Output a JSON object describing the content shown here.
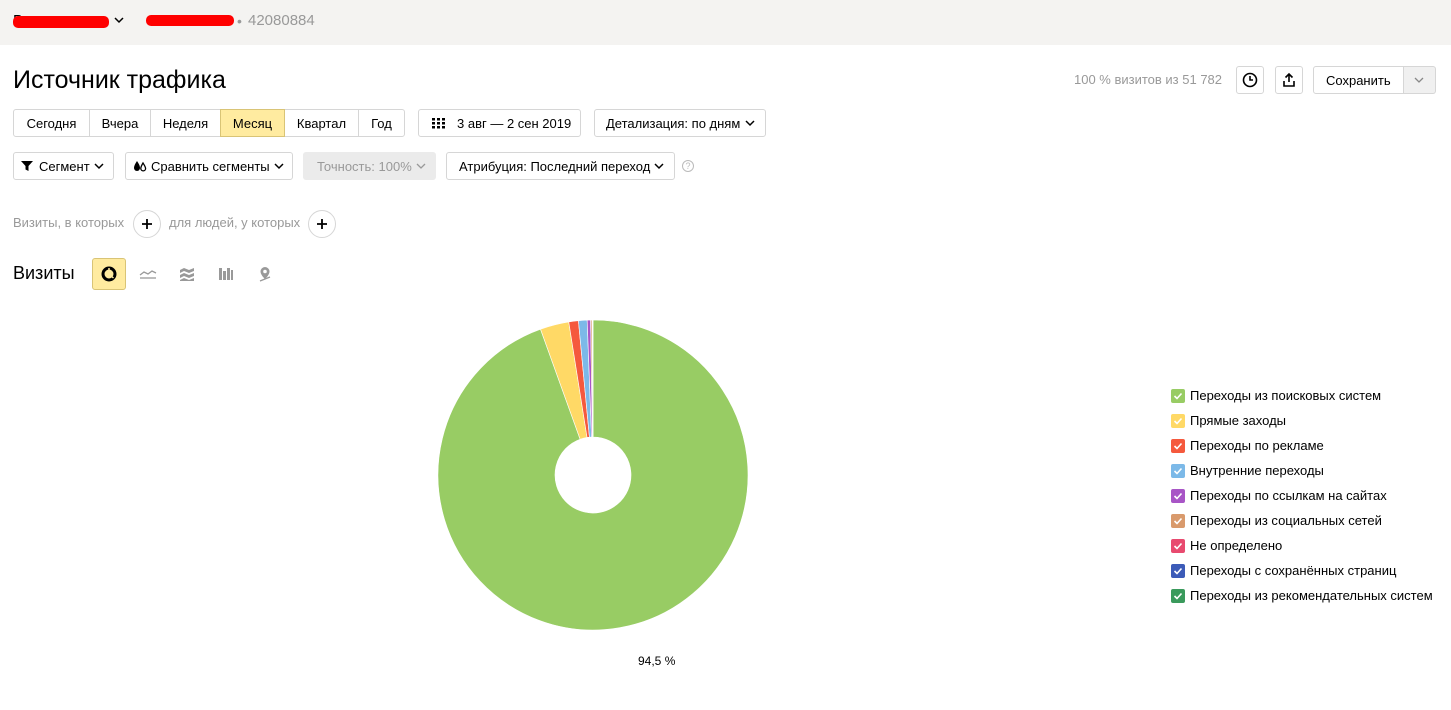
{
  "header": {
    "counter_name": "В",
    "counter_id": "42080884",
    "separator": "•"
  },
  "title": "Источник трафика",
  "visits_summary": "100 % визитов из 51 782",
  "toolbar": {
    "save_label": "Сохранить",
    "history_icon": "clock-icon",
    "export_icon": "share-icon"
  },
  "periods": [
    {
      "label": "Сегодня",
      "active": false
    },
    {
      "label": "Вчера",
      "active": false
    },
    {
      "label": "Неделя",
      "active": false
    },
    {
      "label": "Месяц",
      "active": true
    },
    {
      "label": "Квартал",
      "active": false
    },
    {
      "label": "Год",
      "active": false
    }
  ],
  "date_range": "3 авг — 2 сен 2019",
  "detail": "Детализация: по дням",
  "filters": {
    "segment": "Сегмент",
    "compare": "Сравнить сегменты",
    "accuracy": "Точность: 100%",
    "attribution": "Атрибуция: Последний переход",
    "help": "?"
  },
  "conditions": {
    "visits_text": "Визиты, в которых",
    "people_text": "для людей, у которых"
  },
  "chart_section_title": "Визиты",
  "chart_types": [
    "pie-chart-icon",
    "line-chart-icon",
    "area-chart-icon",
    "bar-chart-icon",
    "map-icon"
  ],
  "colors": {
    "accent": "#ffeba0",
    "check": "#ffffff"
  },
  "chart_data": {
    "type": "pie",
    "donut": true,
    "slices": [
      {
        "label": "Переходы из поисковых систем",
        "value": 94.5,
        "color": "#98cc64"
      },
      {
        "label": "Прямые заходы",
        "value": 3.0,
        "color": "#ffd966"
      },
      {
        "label": "Переходы по рекламе",
        "value": 1.0,
        "color": "#f5593d"
      },
      {
        "label": "Внутренние переходы",
        "value": 0.9,
        "color": "#7cb9e8"
      },
      {
        "label": "Переходы по ссылкам на сайтах",
        "value": 0.35,
        "color": "#a855c6"
      },
      {
        "label": "Переходы из социальных сетей",
        "value": 0.15,
        "color": "#d99a6c"
      },
      {
        "label": "Не определено",
        "value": 0.05,
        "color": "#e84a6f"
      },
      {
        "label": "Переходы с сохранённых страниц",
        "value": 0.03,
        "color": "#3c5bb8"
      },
      {
        "label": "Переходы из рекомендательных систем",
        "value": 0.02,
        "color": "#3a9a5c"
      }
    ],
    "data_labels": [
      "94,5 %"
    ]
  }
}
